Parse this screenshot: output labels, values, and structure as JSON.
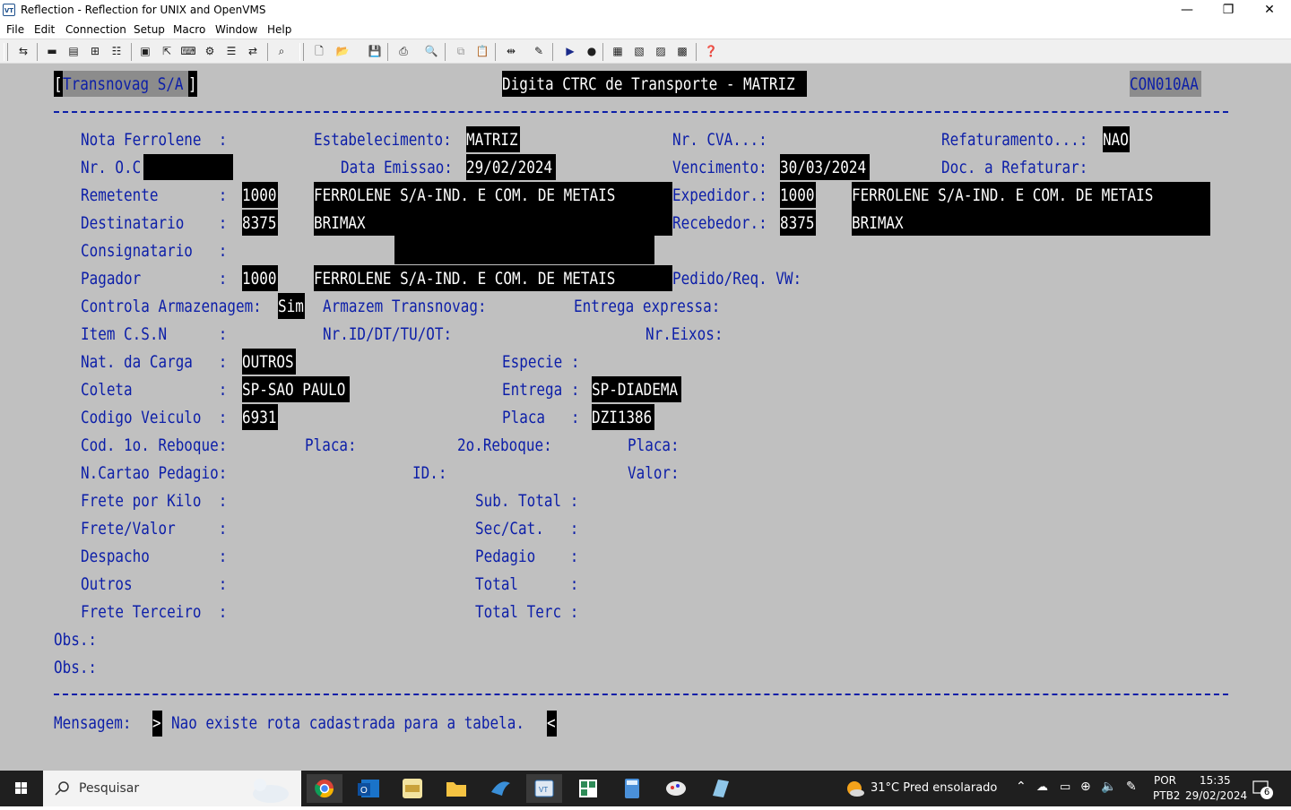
{
  "window": {
    "title": "Reflection - Reflection for UNIX and OpenVMS",
    "app_icon": "VT",
    "controls": {
      "minimize": "—",
      "restore": "❐",
      "close": "✕"
    }
  },
  "menu": [
    "File",
    "Edit",
    "Connection",
    "Setup",
    "Macro",
    "Window",
    "Help"
  ],
  "toolbar_icons": [
    "connect-icon",
    "terminal-icon",
    "terminal2-icon",
    "hosts-icon",
    "session-icon",
    "display-icon",
    "cursor-icon",
    "keyboard-icon",
    "mapping-icon",
    "settings-icon",
    "new-icon",
    "open-icon",
    "save-icon",
    "print-icon",
    "find-icon",
    "copy-icon",
    "paste-icon",
    "disconnect-icon",
    "script-icon",
    "play-icon",
    "record-icon",
    "view1-icon",
    "view2-icon",
    "view3-icon",
    "view4-icon",
    "help-icon"
  ],
  "screen": {
    "company": "Transnovag S/A",
    "bracket_left": "[",
    "bracket_right": "]",
    "title": "Digita CTRC de Transporte - MATRIZ",
    "program": "CON010AA",
    "labels": {
      "nota_ferrolene": "Nota Ferrolene  :",
      "estabelecimento": "Estabelecimento:",
      "nr_cva": "Nr. CVA...:",
      "refaturamento": "Refaturamento...:",
      "nr_oc": "Nr. O.C",
      "data_emissao": "Data Emissao:",
      "vencimento": "Vencimento:",
      "doc_refaturar": "Doc. a Refaturar:",
      "remetente": "Remetente       :",
      "expedidor": "Expedidor.:",
      "destinatario": "Destinatario    :",
      "recebedor": "Recebedor.:",
      "consignatario": "Consignatario   :",
      "pagador": "Pagador         :",
      "pedido_req": "Pedido/Req. VW:",
      "controla_armazenagem": "Controla Armazenagem:",
      "armazem_transnovag": "Armazem Transnovag:",
      "entrega_expressa": "Entrega expressa:",
      "item_csn": "Item C.S.N      :",
      "nr_id": "Nr.ID/DT/TU/OT:",
      "nr_eixos": "Nr.Eixos:",
      "nat_carga": "Nat. da Carga   :",
      "especie": "Especie :",
      "coleta": "Coleta          :",
      "entrega": "Entrega :",
      "codigo_veiculo": "Codigo Veiculo  :",
      "placa": "Placa   :",
      "cod_reboque1": "Cod. 1o. Reboque:",
      "placa1": "Placa:",
      "reboque2": "2o.Reboque:",
      "placa2": "Placa:",
      "cartao_pedagio": "N.Cartao Pedagio:",
      "id": "ID.:",
      "valor": "Valor:",
      "frete_kilo": "Frete por Kilo  :",
      "sub_total": "Sub. Total :",
      "frete_valor": "Frete/Valor     :",
      "sec_cat": "Sec/Cat.   :",
      "despacho": "Despacho        :",
      "pedagio": "Pedagio    :",
      "outros": "Outros          :",
      "total": "Total      :",
      "frete_terceiro": "Frete Terceiro  :",
      "total_terc": "Total Terc :",
      "obs1": "Obs.:",
      "obs2": "Obs.:",
      "mensagem": "Mensagem:"
    },
    "values": {
      "estabelecimento": "MATRIZ",
      "refaturamento": "NAO",
      "data_emissao": "29/02/2024",
      "vencimento": "30/03/2024",
      "remetente_cod": "1000",
      "remetente_nome": "FERROLENE S/A-IND. E COM. DE METAIS",
      "expedidor_cod": "1000",
      "expedidor_nome": "FERROLENE S/A-IND. E COM. DE METAIS",
      "destinatario_cod": "8375",
      "destinatario_nome": "BRIMAX",
      "recebedor_cod": "8375",
      "recebedor_nome": "BRIMAX",
      "pagador_cod": "1000",
      "pagador_nome": "FERROLENE S/A-IND. E COM. DE METAIS",
      "controla_armazenagem": "Sim",
      "nat_carga": "OUTROS",
      "coleta": "SP-SAO PAULO",
      "entrega": "SP-DIADEMA",
      "codigo_veiculo": "6931",
      "placa": "DZI1386"
    },
    "message_open": ">",
    "message": "Nao existe rota cadastrada para a tabela.",
    "message_close": "<"
  },
  "taskbar": {
    "search_placeholder": "Pesquisar",
    "weather": "31°C  Pred ensolarado",
    "lang1": "POR",
    "lang2": "PTB2",
    "time": "15:35",
    "date": "29/02/2024",
    "notifications": "6"
  }
}
